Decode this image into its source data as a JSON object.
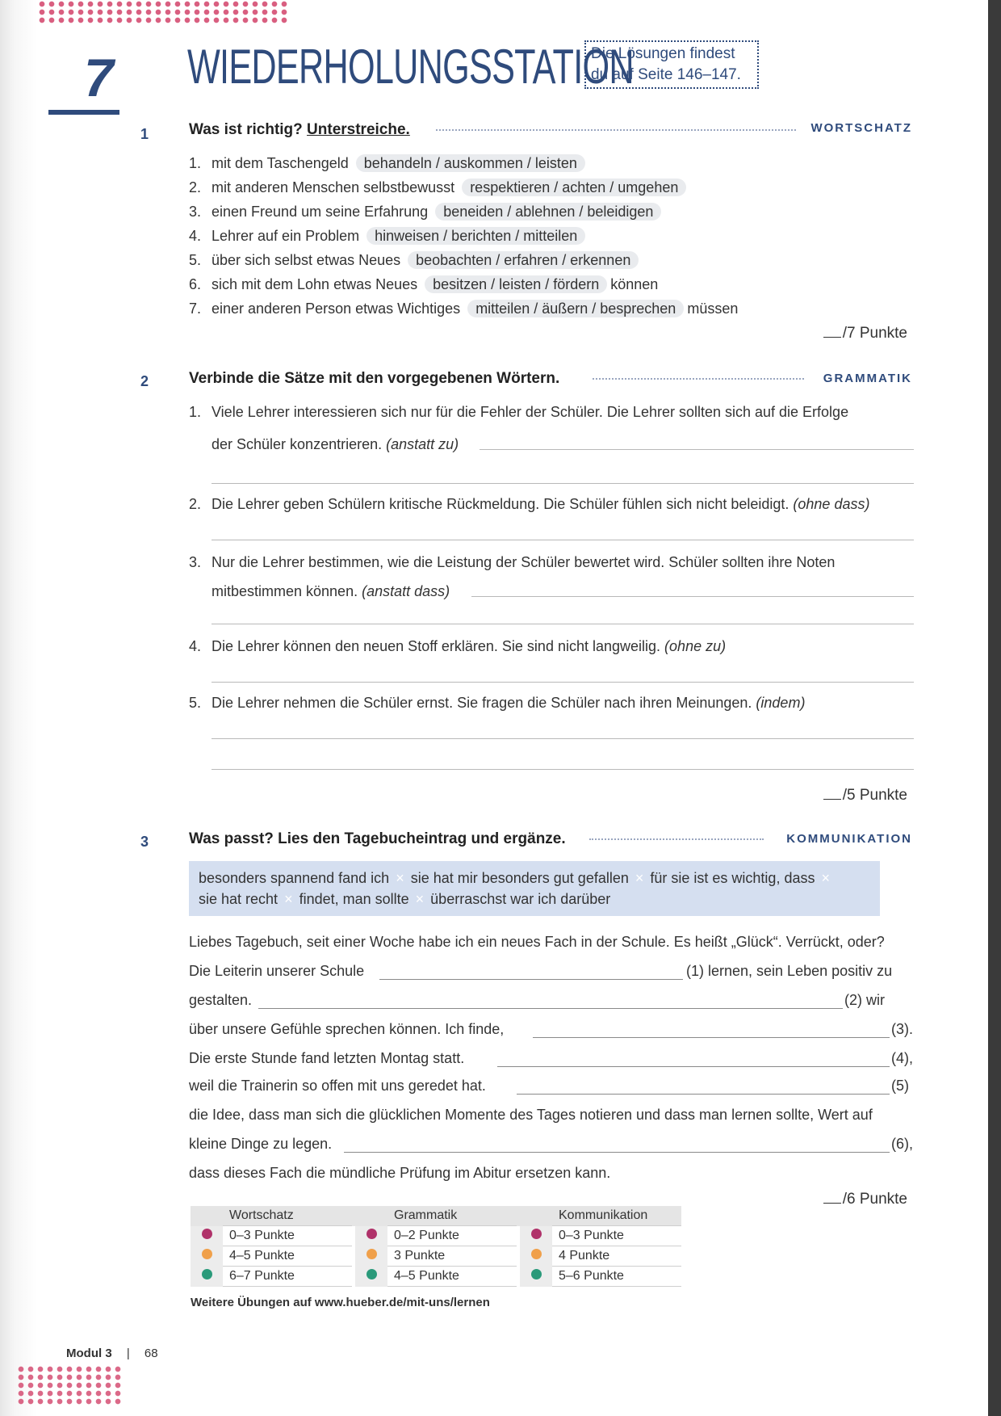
{
  "header": {
    "chapter_number": "7",
    "title": "WIEDERHOLUNGSSTATION",
    "solution_line1": "Die Lösungen findest",
    "solution_line2": "du auf Seite 146–147."
  },
  "exercise1": {
    "number": "1",
    "title_plain": "Was ist richtig? ",
    "title_underlined": "Unterstreiche.",
    "tag": "WORTSCHATZ",
    "items": [
      {
        "n": "1.",
        "text": "mit dem Taschengeld",
        "options": "behandeln / auskommen / leisten",
        "after": ""
      },
      {
        "n": "2.",
        "text": "mit anderen Menschen selbstbewusst",
        "options": "respektieren / achten / umgehen",
        "after": ""
      },
      {
        "n": "3.",
        "text": "einen Freund um seine Erfahrung",
        "options": "beneiden / ablehnen / beleidigen",
        "after": ""
      },
      {
        "n": "4.",
        "text": "Lehrer auf ein Problem",
        "options": "hinweisen / berichten / mitteilen",
        "after": ""
      },
      {
        "n": "5.",
        "text": "über sich selbst etwas Neues",
        "options": "beobachten / erfahren / erkennen",
        "after": ""
      },
      {
        "n": "6.",
        "text": "sich mit dem Lohn etwas Neues",
        "options": "besitzen / leisten / fördern",
        "after": "können"
      },
      {
        "n": "7.",
        "text": "einer anderen Person etwas Wichtiges",
        "options": "mitteilen / äußern / besprechen",
        "after": "müssen"
      }
    ],
    "score": "/7 Punkte"
  },
  "exercise2": {
    "number": "2",
    "title": "Verbinde die Sätze mit den vorgegebenen Wörtern.",
    "tag": "GRAMMATIK",
    "items": [
      {
        "n": "1.",
        "line1": "Viele Lehrer interessieren sich nur für die Fehler der Schüler. Die Lehrer sollten sich auf die Erfolge",
        "line2": "der Schüler konzentrieren.",
        "hint": "(anstatt zu)"
      },
      {
        "n": "2.",
        "line1": "Die Lehrer geben Schülern kritische Rückmeldung. Die Schüler fühlen sich nicht beleidigt.",
        "hint": "(ohne dass)"
      },
      {
        "n": "3.",
        "line1": "Nur die Lehrer bestimmen, wie die Leistung der Schüler bewertet wird. Schüler sollten ihre Noten",
        "line2": "mitbestimmen können.",
        "hint": "(anstatt dass)"
      },
      {
        "n": "4.",
        "line1": "Die Lehrer können den neuen Stoff erklären. Sie sind nicht langweilig.",
        "hint": "(ohne zu)"
      },
      {
        "n": "5.",
        "line1": "Die Lehrer nehmen die Schüler ernst. Sie fragen die Schüler nach ihren Meinungen.",
        "hint": "(indem)"
      }
    ],
    "score": "/5 Punkte"
  },
  "exercise3": {
    "number": "3",
    "title": "Was passt? Lies den Tagebucheintrag und ergänze.",
    "tag": "KOMMUNIKATION",
    "phrases": [
      "besonders spannend fand ich",
      "sie hat mir besonders gut gefallen",
      "für sie ist es wichtig, dass",
      "sie hat recht",
      "findet, man sollte",
      "überraschst war ich darüber"
    ],
    "text": {
      "l1": "Liebes Tagebuch, seit einer Woche habe ich ein neues Fach in der Schule. Es heißt „Glück“. Verrückt, oder?",
      "l2a": "Die Leiterin unserer Schule",
      "l2b": "(1) lernen, sein Leben positiv zu",
      "l3a": "gestalten.",
      "l3b": "(2) wir",
      "l4a": "über unsere Gefühle sprechen können.  Ich finde,",
      "l4b": "(3).",
      "l5a": "Die erste Stunde fand letzten Montag statt.",
      "l5b": "(4),",
      "l6a": "weil die Trainerin so offen mit uns geredet hat.",
      "l6b": "(5)",
      "l7": "die Idee, dass man sich die glücklichen Momente des Tages notieren und dass man lernen sollte, Wert auf",
      "l8a": "kleine Dinge zu legen.",
      "l8b": "(6),",
      "l9": "dass dieses Fach die mündliche Prüfung im Abitur ersetzen kann."
    },
    "score": "/6 Punkte"
  },
  "evaluation": {
    "headers": [
      "Wortschatz",
      "Grammatik",
      "Kommunikation"
    ],
    "rows": [
      [
        "0–3 Punkte",
        "0–2 Punkte",
        "0–3 Punkte"
      ],
      [
        "4–5 Punkte",
        "3 Punkte",
        "4 Punkte"
      ],
      [
        "6–7 Punkte",
        "4–5 Punkte",
        "5–6 Punkte"
      ]
    ],
    "dot_colors": [
      "#b0326a",
      "#f0a04a",
      "#2a9a7a"
    ]
  },
  "footer": {
    "link_text": "Weitere Übungen auf www.hueber.de/mit-uns/lernen",
    "module": "Modul 3",
    "separator": "|",
    "page": "68"
  }
}
